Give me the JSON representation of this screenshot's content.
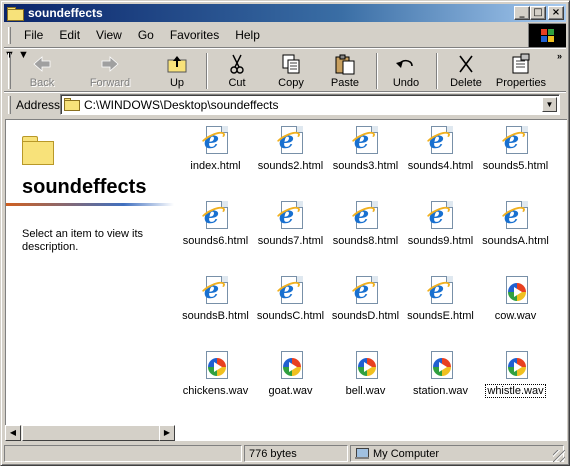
{
  "window": {
    "title": "soundeffects"
  },
  "title_buttons": {
    "minimize": "_",
    "maximize": "□",
    "close": "×"
  },
  "menu": [
    {
      "label": "File"
    },
    {
      "label": "Edit"
    },
    {
      "label": "View"
    },
    {
      "label": "Go"
    },
    {
      "label": "Favorites"
    },
    {
      "label": "Help"
    }
  ],
  "toolbar": {
    "back": "Back",
    "forward": "Forward",
    "up": "Up",
    "cut": "Cut",
    "copy": "Copy",
    "paste": "Paste",
    "undo": "Undo",
    "delete": "Delete",
    "properties": "Properties",
    "overflow": "»"
  },
  "address": {
    "label": "Address",
    "value": "C:\\WINDOWS\\Desktop\\soundeffects"
  },
  "left_pane": {
    "folder_name": "soundeffects",
    "description": "Select an item to view its description."
  },
  "files": [
    {
      "name": "index.html",
      "type": "html"
    },
    {
      "name": "sounds2.html",
      "type": "html"
    },
    {
      "name": "sounds3.html",
      "type": "html"
    },
    {
      "name": "sounds4.html",
      "type": "html"
    },
    {
      "name": "sounds5.html",
      "type": "html"
    },
    {
      "name": "sounds6.html",
      "type": "html"
    },
    {
      "name": "sounds7.html",
      "type": "html"
    },
    {
      "name": "sounds8.html",
      "type": "html"
    },
    {
      "name": "sounds9.html",
      "type": "html"
    },
    {
      "name": "soundsA.html",
      "type": "html"
    },
    {
      "name": "soundsB.html",
      "type": "html"
    },
    {
      "name": "soundsC.html",
      "type": "html"
    },
    {
      "name": "soundsD.html",
      "type": "html"
    },
    {
      "name": "soundsE.html",
      "type": "html"
    },
    {
      "name": "cow.wav",
      "type": "wav"
    },
    {
      "name": "chickens.wav",
      "type": "wav"
    },
    {
      "name": "goat.wav",
      "type": "wav"
    },
    {
      "name": "bell.wav",
      "type": "wav"
    },
    {
      "name": "station.wav",
      "type": "wav"
    },
    {
      "name": "whistle.wav",
      "type": "wav",
      "focused": true
    }
  ],
  "status": {
    "size": "776 bytes",
    "zone": "My Computer"
  },
  "colors": {
    "title_gradient_start": "#0a246a",
    "title_gradient_end": "#a6caf0",
    "face": "#d4d0c8",
    "ie_blue": "#1870d0"
  }
}
